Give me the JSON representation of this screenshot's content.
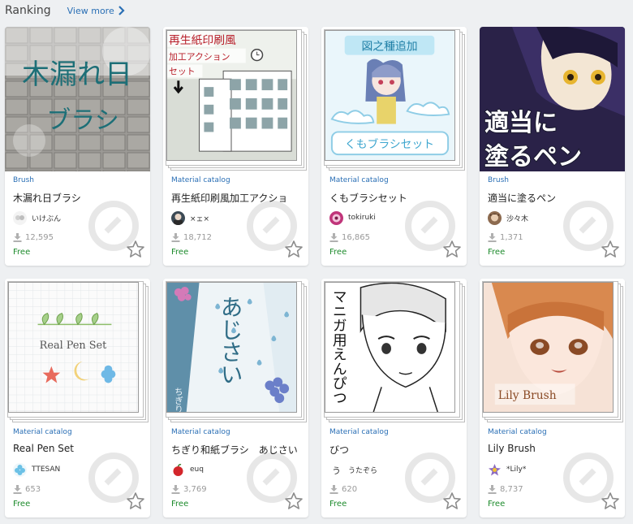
{
  "header": {
    "title": "Ranking",
    "view_more": "View more"
  },
  "colors": {
    "link": "#2a6fb5",
    "free": "#1c8a2b",
    "muted": "#9a9a9a"
  },
  "icons": {
    "download": "download-icon",
    "favorite": "star-outline-icon",
    "more": "chevron-right-icon"
  },
  "cards": [
    {
      "category": "Brush",
      "name": "木漏れ日ブラシ",
      "author": "いけぶん",
      "downloads": "12,595",
      "price": "Free",
      "thumb_text": [
        "木漏れ日",
        "ブラシ"
      ]
    },
    {
      "category": "Material catalog",
      "name": "再生紙印刷風加工アクショ",
      "author": "×ェ×",
      "downloads": "18,712",
      "price": "Free",
      "thumb_text": [
        "再生紙印刷風",
        "加工アクション",
        "セット"
      ]
    },
    {
      "category": "Material catalog",
      "name": "くもブラシセット",
      "author": "tokiruki",
      "downloads": "16,865",
      "price": "Free",
      "thumb_text": [
        "図之種追加",
        "くもブラシセット"
      ]
    },
    {
      "category": "Brush",
      "name": "適当に塗るペン",
      "author": "沙々木",
      "downloads": "1,371",
      "price": "Free",
      "thumb_text": [
        "適当に",
        "塗るペン"
      ]
    },
    {
      "category": "Material catalog",
      "name": "Real Pen Set",
      "author": "TTESAN",
      "downloads": "653",
      "price": "Free",
      "thumb_text": [
        "Real Pen Set"
      ]
    },
    {
      "category": "Material catalog",
      "name": "ちぎり和紙ブラシ　あじさい",
      "author": "euq",
      "downloads": "3,769",
      "price": "Free",
      "thumb_text": [
        "あじさい",
        "ちぎり和紙"
      ]
    },
    {
      "category": "Material catalog",
      "name": "びつ",
      "author": "うたぞら",
      "downloads": "620",
      "price": "Free",
      "thumb_text": [
        "マニガ用えんぴつ"
      ]
    },
    {
      "category": "Material catalog",
      "name": "Lily Brush",
      "author": "*Lily*",
      "downloads": "8,737",
      "price": "Free",
      "thumb_text": [
        "Lily Brush"
      ]
    }
  ]
}
